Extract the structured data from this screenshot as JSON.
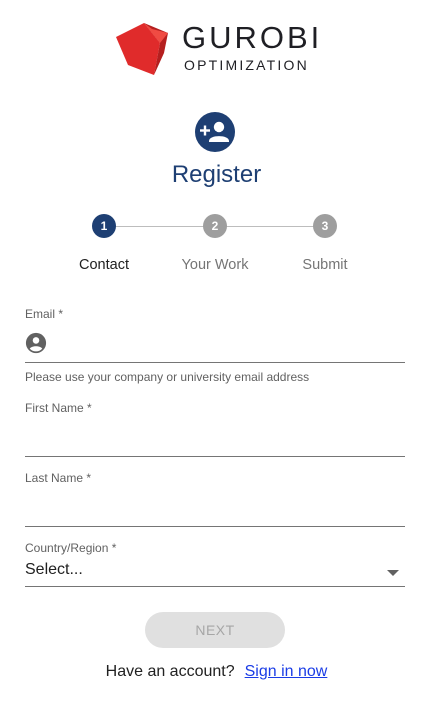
{
  "logo": {
    "word": "GUROBI",
    "sub": "OPTIMIZATION"
  },
  "header": {
    "icon": "person-add-icon",
    "title": "Register"
  },
  "stepper": {
    "steps": [
      {
        "number": "1",
        "label": "Contact",
        "state": "active"
      },
      {
        "number": "2",
        "label": "Your Work",
        "state": "inactive"
      },
      {
        "number": "3",
        "label": "Submit",
        "state": "inactive"
      }
    ]
  },
  "form": {
    "email": {
      "label": "Email *",
      "value": "",
      "icon": "account-circle-icon",
      "helper": "Please use your company or university email address"
    },
    "first_name": {
      "label": "First Name *",
      "value": ""
    },
    "last_name": {
      "label": "Last Name *",
      "value": ""
    },
    "country": {
      "label": "Country/Region *",
      "value": "Select..."
    }
  },
  "actions": {
    "next_label": "NEXT"
  },
  "footer": {
    "prompt": "Have an account?",
    "link_label": "Sign in now"
  },
  "colors": {
    "primary": "#1e3f73",
    "logo_red": "#e02b2b",
    "link": "#1a3ce6",
    "inactive_step": "#9e9e9e"
  }
}
